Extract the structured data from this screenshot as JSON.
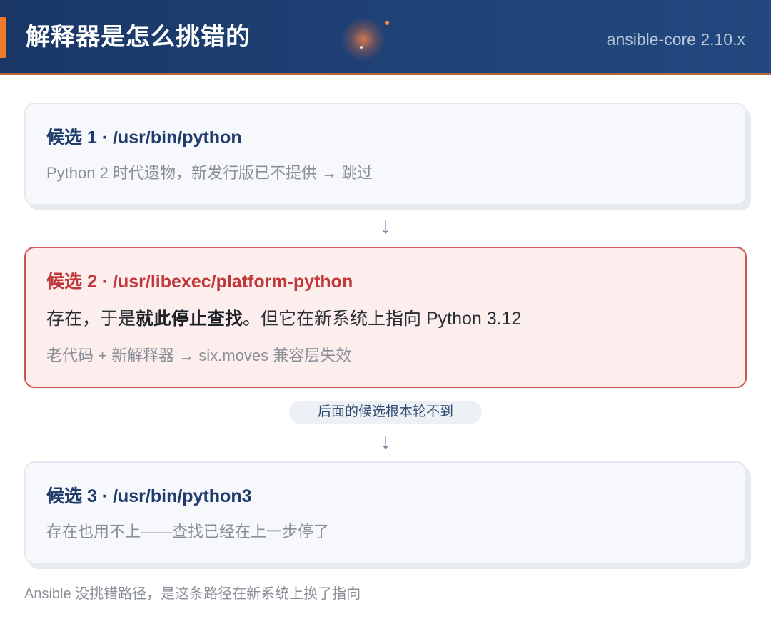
{
  "header": {
    "title": "解释器是怎么挑错的",
    "version": "ansible-core 2.10.x"
  },
  "candidates": [
    {
      "title": "候选 1 · /usr/bin/python",
      "note": "Python 2 时代遗物，新发行版已不提供 → 跳过"
    },
    {
      "title": "候选 2 · /usr/libexec/platform-python",
      "main_prefix": "存在，于是",
      "main_bold": "就此停止查找",
      "main_suffix": "。但它在新系统上指向 Python 3.12",
      "note": "老代码 + 新解释器 → six.moves 兼容层失效"
    },
    {
      "title": "候选 3 · /usr/bin/python3",
      "note": "存在也用不上——查找已经在上一步停了"
    }
  ],
  "arrows": {
    "symbol": "↓"
  },
  "pill_label": "后面的候选根本轮不到",
  "footer": "Ansible 没挑错路径，是这条路径在新系统上换了指向",
  "colors": {
    "header_bg": "#1e4176",
    "accent": "#ef7a2d",
    "highlight_border": "#cf5454",
    "highlight_title": "#c0383a",
    "title_navy": "#1f3c6c"
  }
}
